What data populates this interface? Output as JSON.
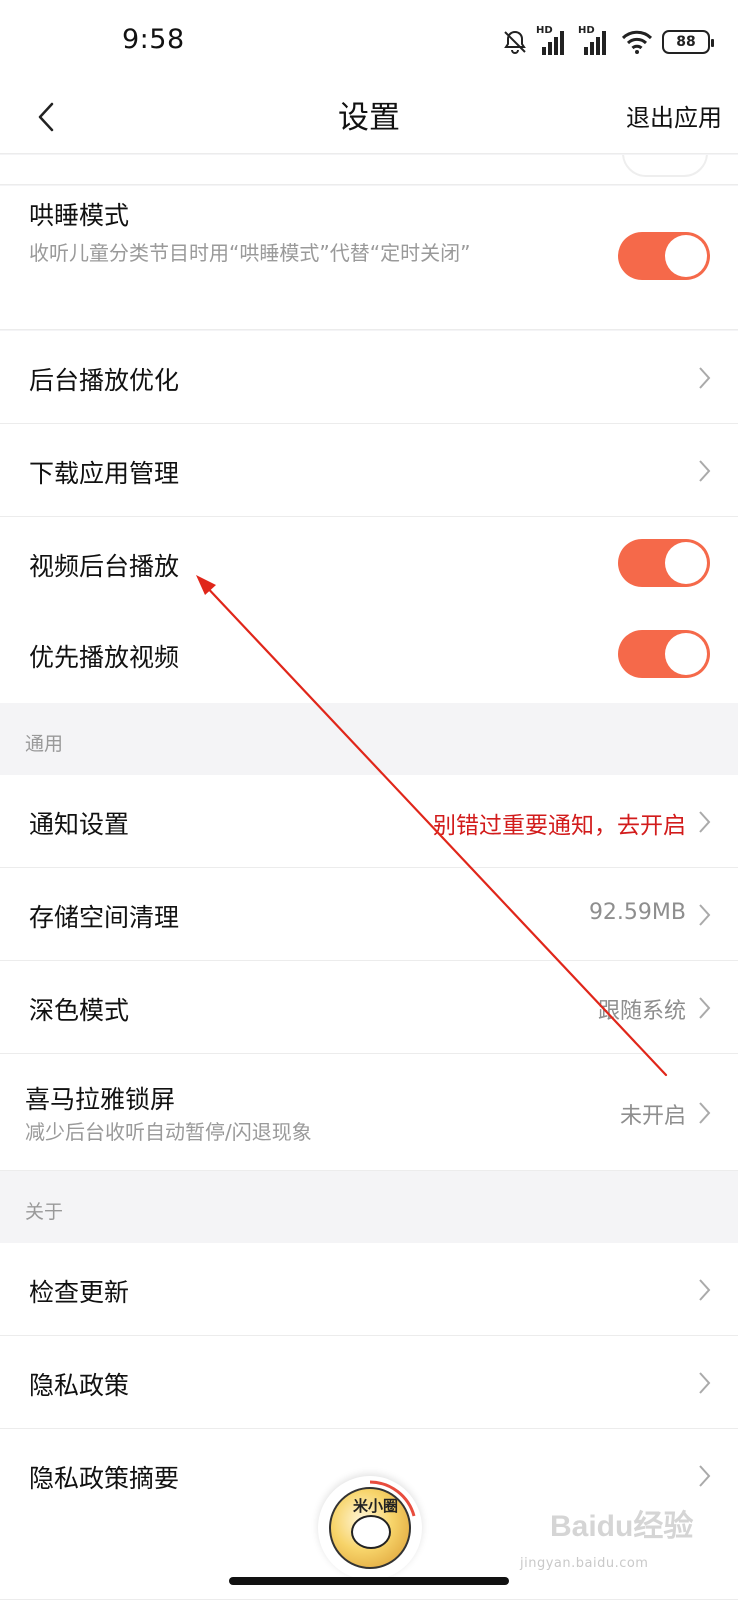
{
  "status_bar": {
    "time": "9:58",
    "signal1_label": "HD",
    "signal2_label": "HD",
    "battery": "88",
    "icons": [
      "bell-off-icon",
      "signal-icon",
      "signal-icon",
      "wifi-icon",
      "battery-icon"
    ]
  },
  "nav": {
    "title": "设置",
    "exit_label": "退出应用",
    "back_icon": "chevron-left-icon"
  },
  "rows": {
    "sleep_mode": {
      "title": "哄睡模式",
      "desc": "收听儿童分类节目时用“哄睡模式”代替“定时关闭”",
      "toggle_on": true
    },
    "background_opt": {
      "title": "后台播放优化"
    },
    "download_mgr": {
      "title": "下载应用管理"
    },
    "video_bg": {
      "title": "视频后台播放",
      "toggle_on": true
    },
    "video_first": {
      "title": "优先播放视频",
      "toggle_on": true
    }
  },
  "sections": {
    "general": "通用",
    "about": "关于"
  },
  "general_rows": {
    "notify": {
      "title": "通知设置",
      "value": "别错过重要通知，去开启"
    },
    "storage": {
      "title": "存储空间清理",
      "value": "92.59MB"
    },
    "dark": {
      "title": "深色模式",
      "value": "跟随系统"
    },
    "lockscreen": {
      "title": "喜马拉雅锁屏",
      "desc": "减少后台收听自动暂停/闪退现象",
      "value": "未开启"
    }
  },
  "about_rows": {
    "update": {
      "title": "检查更新"
    },
    "privacy": {
      "title": "隐私政策"
    },
    "privacy_summary": {
      "title": "隐私政策摘要"
    }
  },
  "mini_player": {
    "cover_text": "米小圈"
  },
  "watermark": {
    "brand": "Baidu经验",
    "url": "jingyan.baidu.com"
  },
  "colors": {
    "accent": "#f5694a",
    "notify_red": "#d21b1b",
    "annotation_arrow": "#e0261a"
  }
}
